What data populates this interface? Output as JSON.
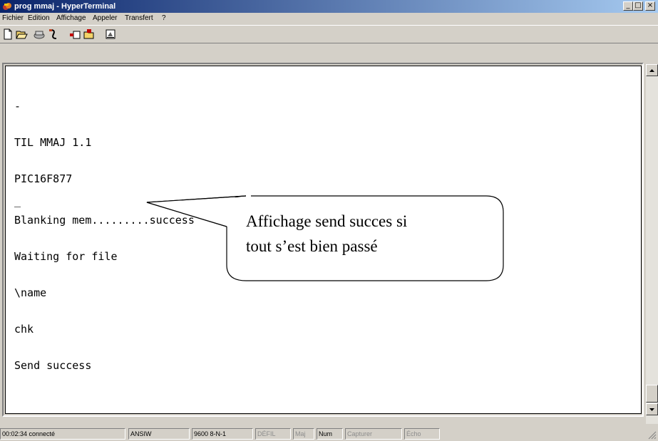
{
  "window": {
    "title": "prog mmaj - HyperTerminal",
    "icon": "hyperterminal-icon",
    "controls": {
      "minimize": "_",
      "restore": "□",
      "close": "×"
    }
  },
  "menu": [
    "Fichier",
    "Edition",
    "Affichage",
    "Appeler",
    "Transfert",
    "?"
  ],
  "toolbar": {
    "tools": [
      "new-icon",
      "open-icon",
      "call-icon",
      "disconnect-icon",
      "send-icon",
      "receive-icon",
      "properties-icon"
    ]
  },
  "terminal": {
    "lines": [
      "-",
      "TIL MMAJ 1.1",
      "PIC16F877",
      "Blanking mem.........success",
      "Waiting for file",
      "\\name",
      "chk",
      "Send success"
    ],
    "cursor": "_"
  },
  "callout": {
    "line1": "Affichage send succes si",
    "line2": "tout s’est bien passé"
  },
  "status": {
    "connection": "00:02:34 connecté",
    "emulation": "ANSIW",
    "settings": "9600 8-N-1",
    "scroll": "DÉFIL",
    "caps": "Maj",
    "num": "Num",
    "capture": "Capturer",
    "echo": "Écho"
  },
  "colors": {
    "titlebar_start": "#0a246a",
    "titlebar_end": "#a6caf0",
    "chrome": "#d4d0c8",
    "terminal_bg": "#ffffff"
  }
}
